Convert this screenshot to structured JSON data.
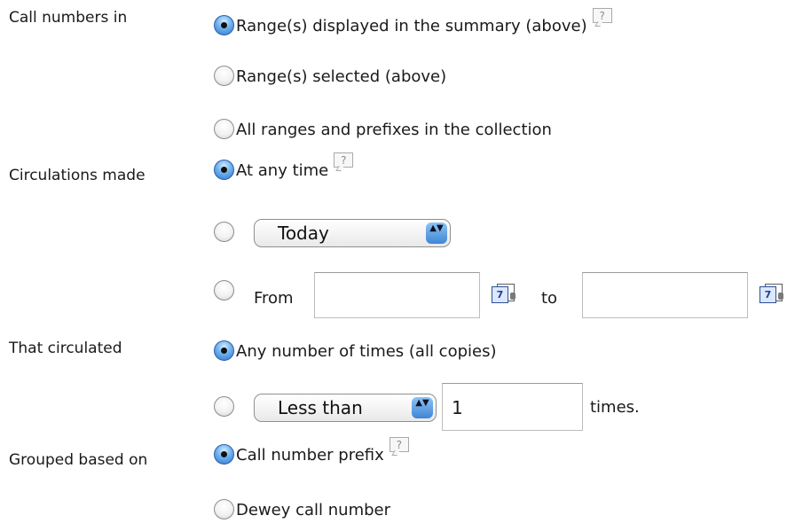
{
  "labels": {
    "call_numbers": "Call numbers in",
    "circulations": "Circulations made",
    "circulated": "That circulated",
    "grouped": "Grouped based on"
  },
  "call_numbers_options": [
    "Range(s) displayed in the summary (above)",
    "Range(s) selected (above)",
    "All ranges and prefixes in the collection"
  ],
  "circulations_options": {
    "any_time": "At any time",
    "period_select_value": "Today",
    "from_label": "From",
    "to_label": "to",
    "from_value": "",
    "to_value": ""
  },
  "circulated_options": {
    "any_number": "Any number of times (all copies)",
    "comparison_select_value": "Less than",
    "count_value": "1",
    "times_label": "times."
  },
  "grouped_options": [
    "Call number prefix",
    "Dewey call number"
  ],
  "help_icon_text": "?",
  "calendar_icon_text": "7",
  "select_arrows": "▲▼"
}
